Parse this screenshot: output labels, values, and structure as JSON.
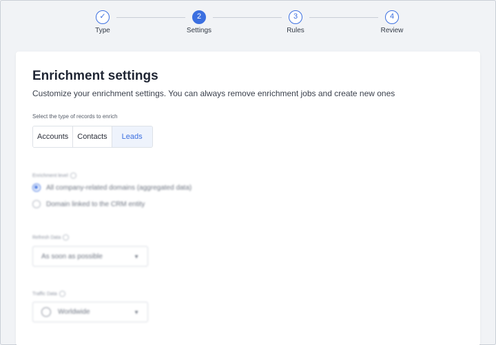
{
  "stepper": {
    "steps": [
      {
        "number": "✓",
        "label": "Type"
      },
      {
        "number": "2",
        "label": "Settings"
      },
      {
        "number": "3",
        "label": "Rules"
      },
      {
        "number": "4",
        "label": "Review"
      }
    ],
    "accent": "#3b6fe0"
  },
  "header": {
    "title": "Enrichment settings",
    "subtitle": "Customize your enrichment settings. You can always remove enrichment jobs and create new ones"
  },
  "records": {
    "label": "Select the type of records to enrich",
    "options": [
      "Accounts",
      "Contacts",
      "Leads"
    ],
    "selected": "Leads"
  },
  "enrichment_level": {
    "label": "Enrichment level",
    "options": [
      {
        "label": "All company-related domains (aggregated data)",
        "checked": true
      },
      {
        "label": "Domain linked to the CRM entity",
        "checked": false
      }
    ]
  },
  "refresh_data": {
    "label": "Refresh Data",
    "value": "As soon as possible"
  },
  "traffic_data": {
    "label": "Traffic Data",
    "value": "Worldwide"
  }
}
